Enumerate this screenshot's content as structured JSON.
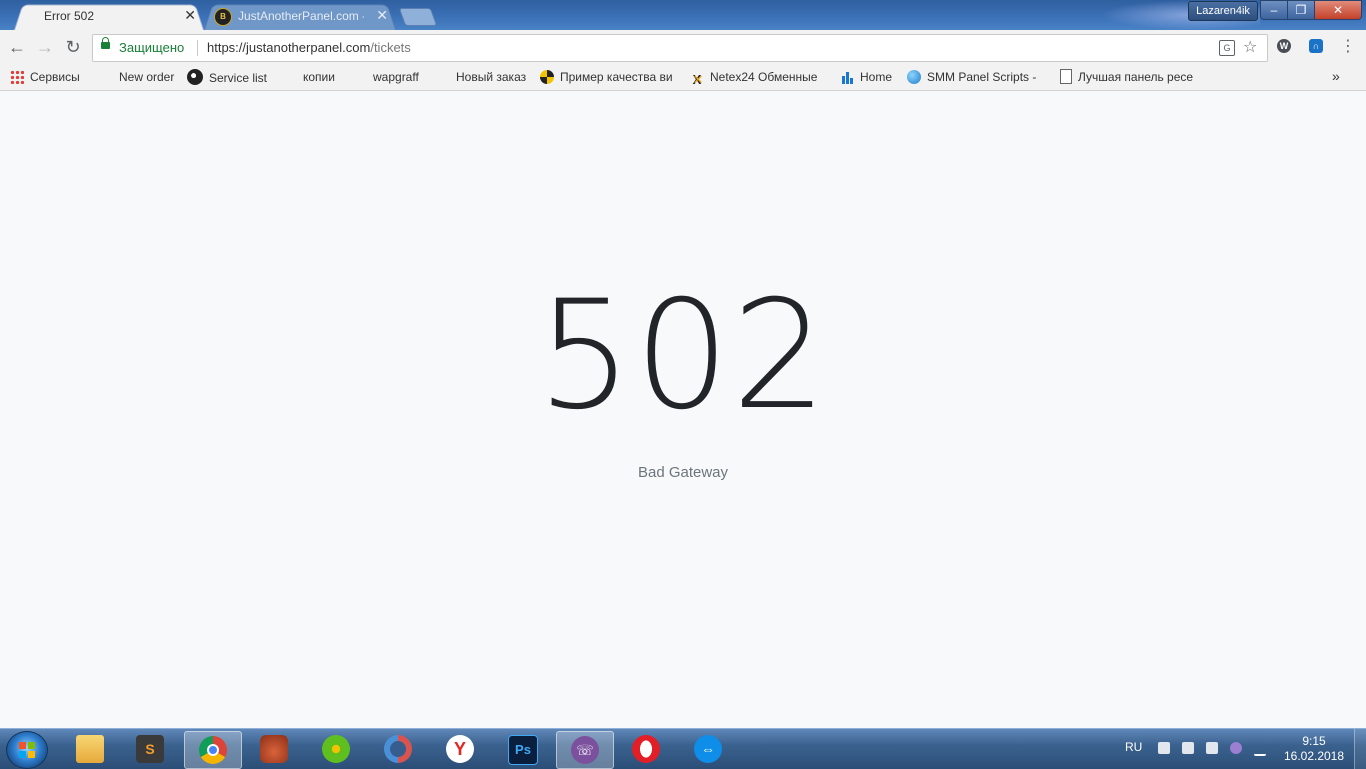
{
  "window": {
    "user_badge": "Lazaren4ik",
    "minimize_label": "–",
    "maximize_label": "❐",
    "close_label": "✕"
  },
  "tabs": [
    {
      "title": "Error 502",
      "active": true
    },
    {
      "title": "JustAnotherPanel.com - !",
      "active": false
    }
  ],
  "tab_close_glyph": "✕",
  "toolbar": {
    "back_glyph": "←",
    "forward_glyph": "→",
    "reload_glyph": "↻",
    "secure_label": "Защищено",
    "url_host": "https://justanotherpanel.com",
    "url_path": "/tickets",
    "translate_glyph": "G",
    "star_glyph": "☆",
    "menu_glyph": "⋮"
  },
  "bookmarks": [
    {
      "label": "Сервисы",
      "icon": "apps-icon"
    },
    {
      "label": "New order",
      "icon": ""
    },
    {
      "label": "Service list",
      "icon": "ball-icon"
    },
    {
      "label": "копии",
      "icon": ""
    },
    {
      "label": "wapgraff",
      "icon": ""
    },
    {
      "label": "Новый заказ",
      "icon": ""
    },
    {
      "label": "Пример качества ви",
      "icon": "hazard-icon"
    },
    {
      "label": "Netex24 Обменные",
      "icon": "x-icon"
    },
    {
      "label": "Home",
      "icon": "chart-icon"
    },
    {
      "label": "SMM Panel Scripts -",
      "icon": "globe-icon"
    },
    {
      "label": "Лучшая панель ресе",
      "icon": "doc-icon"
    }
  ],
  "bookmarks_more": "»",
  "page": {
    "code": "502",
    "message": "Bad Gateway"
  },
  "taskbar": {
    "apps": [
      {
        "name": "file-explorer",
        "icon": "folder-icon"
      },
      {
        "name": "sublime-text",
        "icon": "sublime-icon",
        "glyph": "S"
      },
      {
        "name": "google-chrome",
        "icon": "chrome-icon",
        "active": true
      },
      {
        "name": "game",
        "icon": "colosseum-icon"
      },
      {
        "name": "icq",
        "icon": "icq-icon"
      },
      {
        "name": "sync-app",
        "icon": "sync-icon"
      },
      {
        "name": "yandex-browser",
        "icon": "yandex-icon",
        "glyph": "Y"
      },
      {
        "name": "photoshop",
        "icon": "photoshop-icon",
        "glyph": "Ps"
      },
      {
        "name": "viber",
        "icon": "viber-icon",
        "active": true
      },
      {
        "name": "opera",
        "icon": "opera-icon"
      },
      {
        "name": "teamviewer",
        "icon": "teamviewer-icon"
      }
    ],
    "language": "RU",
    "time": "9:15",
    "date": "16.02.2018"
  }
}
